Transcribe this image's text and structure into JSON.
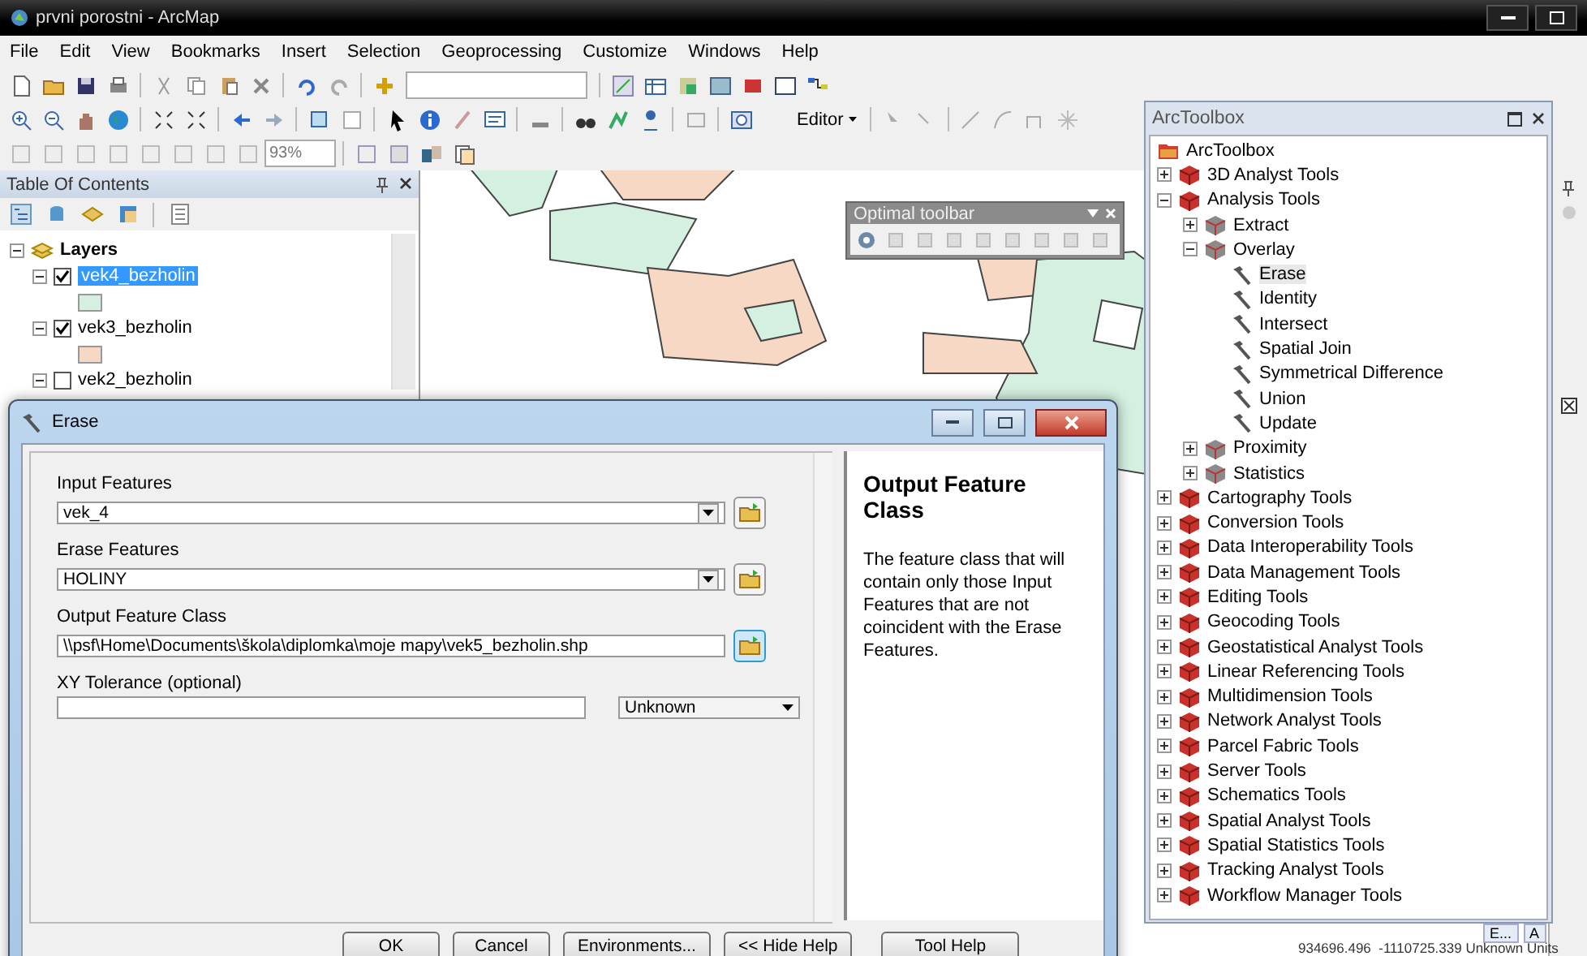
{
  "window": {
    "title": "prvni porostni - ArcMap"
  },
  "menu": [
    "File",
    "Edit",
    "View",
    "Bookmarks",
    "Insert",
    "Selection",
    "Geoprocessing",
    "Customize",
    "Windows",
    "Help"
  ],
  "toolbars": {
    "scale": "93%",
    "editor": "Editor"
  },
  "toc": {
    "title": "Table Of Contents",
    "group": {
      "label": "Layers",
      "expanded": true
    },
    "layers": [
      {
        "name": "vek4_bezholin",
        "checked": true,
        "selected": true,
        "expanded": true,
        "color": "#d4f0e0"
      },
      {
        "name": "vek3_bezholin",
        "checked": true,
        "selected": false,
        "expanded": true,
        "color": "#f6d8c4"
      },
      {
        "name": "vek2_bezholin",
        "checked": false,
        "selected": false,
        "expanded": true
      }
    ]
  },
  "optimal_toolbar": {
    "title": "Optimal toolbar"
  },
  "arctoolbox": {
    "title": "ArcToolbox",
    "root": "ArcToolbox",
    "tree": [
      {
        "label": "3D Analyst Tools",
        "kind": "toolbox",
        "expanded": false
      },
      {
        "label": "Analysis Tools",
        "kind": "toolbox",
        "expanded": true,
        "children": [
          {
            "label": "Extract",
            "kind": "toolset",
            "expanded": false
          },
          {
            "label": "Overlay",
            "kind": "toolset",
            "expanded": true,
            "children": [
              {
                "label": "Erase",
                "kind": "tool",
                "selected": true
              },
              {
                "label": "Identity",
                "kind": "tool",
                "selected": false
              },
              {
                "label": "Intersect",
                "kind": "tool",
                "selected": false
              },
              {
                "label": "Spatial Join",
                "kind": "tool",
                "selected": false
              },
              {
                "label": "Symmetrical Difference",
                "kind": "tool",
                "selected": false
              },
              {
                "label": "Union",
                "kind": "tool",
                "selected": false
              },
              {
                "label": "Update",
                "kind": "tool",
                "selected": false
              }
            ]
          },
          {
            "label": "Proximity",
            "kind": "toolset",
            "expanded": false
          },
          {
            "label": "Statistics",
            "kind": "toolset",
            "expanded": false
          }
        ]
      },
      {
        "label": "Cartography Tools",
        "kind": "toolbox",
        "expanded": false
      },
      {
        "label": "Conversion Tools",
        "kind": "toolbox",
        "expanded": false
      },
      {
        "label": "Data Interoperability Tools",
        "kind": "toolbox",
        "expanded": false
      },
      {
        "label": "Data Management Tools",
        "kind": "toolbox",
        "expanded": false
      },
      {
        "label": "Editing Tools",
        "kind": "toolbox",
        "expanded": false
      },
      {
        "label": "Geocoding Tools",
        "kind": "toolbox",
        "expanded": false
      },
      {
        "label": "Geostatistical Analyst Tools",
        "kind": "toolbox",
        "expanded": false
      },
      {
        "label": "Linear Referencing Tools",
        "kind": "toolbox",
        "expanded": false
      },
      {
        "label": "Multidimension Tools",
        "kind": "toolbox",
        "expanded": false
      },
      {
        "label": "Network Analyst Tools",
        "kind": "toolbox",
        "expanded": false
      },
      {
        "label": "Parcel Fabric Tools",
        "kind": "toolbox",
        "expanded": false
      },
      {
        "label": "Server Tools",
        "kind": "toolbox",
        "expanded": false
      },
      {
        "label": "Schematics Tools",
        "kind": "toolbox",
        "expanded": false
      },
      {
        "label": "Spatial Analyst Tools",
        "kind": "toolbox",
        "expanded": false
      },
      {
        "label": "Spatial Statistics Tools",
        "kind": "toolbox",
        "expanded": false
      },
      {
        "label": "Tracking Analyst Tools",
        "kind": "toolbox",
        "expanded": false
      },
      {
        "label": "Workflow Manager Tools",
        "kind": "toolbox",
        "expanded": false
      }
    ]
  },
  "erase_dialog": {
    "title": "Erase",
    "fields": [
      {
        "label": "Input Features",
        "value": "vek_4",
        "kind": "dropdown"
      },
      {
        "label": "Erase Features",
        "value": "HOLINY",
        "kind": "dropdown"
      },
      {
        "label": "Output Feature Class",
        "value": "\\\\psf\\Home\\Documents\\škola\\diplomka\\moje mapy\\vek5_bezholin.shp",
        "kind": "path"
      },
      {
        "label": "XY Tolerance (optional)",
        "kind": "tolerance",
        "unit": "Unknown"
      }
    ],
    "help": {
      "title": "Output Feature Class",
      "text": "The feature class that will contain only those Input Features that are not coincident with the Erase Features."
    },
    "buttons": [
      "OK",
      "Cancel",
      "Environments...",
      "<< Hide Help",
      "Tool Help"
    ]
  },
  "bottom_tabs": [
    "E...",
    "A"
  ],
  "status_bar": {
    "coordinates": "934696.496  -1110725.339 Unknown Units"
  }
}
